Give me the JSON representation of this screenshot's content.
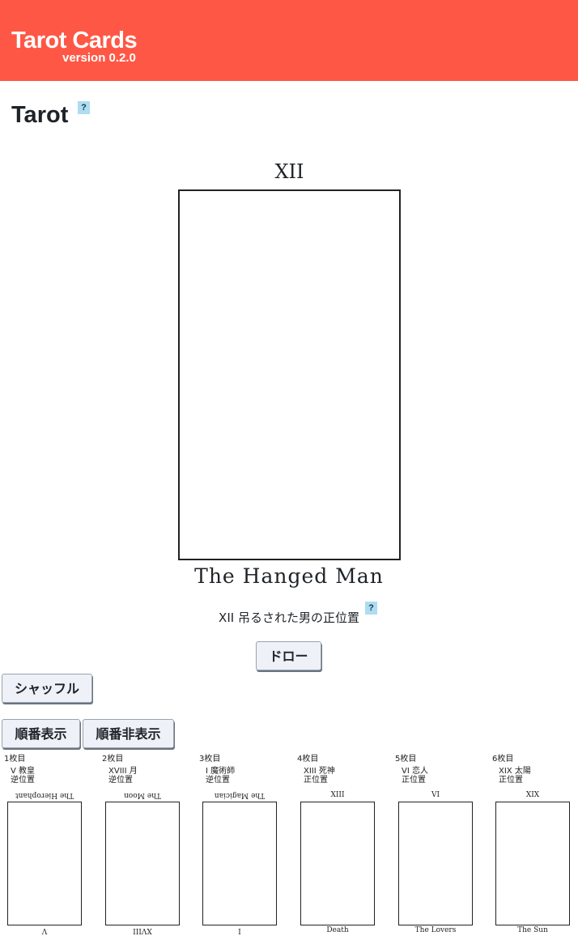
{
  "header": {
    "title": "Tarot Cards",
    "version": "version 0.2.0"
  },
  "page": {
    "title": "Tarot",
    "help_label": "?"
  },
  "drawn_card": {
    "numeral": "XII",
    "name": "The Hanged Man",
    "result_text": "XII 吊るされた男の正位置",
    "help_label": "?"
  },
  "buttons": {
    "draw": "ドロー",
    "shuffle": "シャッフル",
    "show_order": "順番表示",
    "hide_order": "順番非表示"
  },
  "spread": [
    {
      "ordinal": "1枚目",
      "card": "V 教皇",
      "position": "逆位置",
      "top_label": "The Hierophant",
      "bottom_label": "V",
      "reversed": true
    },
    {
      "ordinal": "2枚目",
      "card": "XVIII 月",
      "position": "逆位置",
      "top_label": "The Moon",
      "bottom_label": "XVIII",
      "reversed": true
    },
    {
      "ordinal": "3枚目",
      "card": "I 魔術師",
      "position": "逆位置",
      "top_label": "The Magician",
      "bottom_label": "I",
      "reversed": true
    },
    {
      "ordinal": "4枚目",
      "card": "XIII 死神",
      "position": "正位置",
      "top_label": "XIII",
      "bottom_label": "Death",
      "reversed": false
    },
    {
      "ordinal": "5枚目",
      "card": "VI 恋人",
      "position": "正位置",
      "top_label": "VI",
      "bottom_label": "The Lovers",
      "reversed": false
    },
    {
      "ordinal": "6枚目",
      "card": "XIX 太陽",
      "position": "正位置",
      "top_label": "XIX",
      "bottom_label": "The Sun",
      "reversed": false
    }
  ]
}
